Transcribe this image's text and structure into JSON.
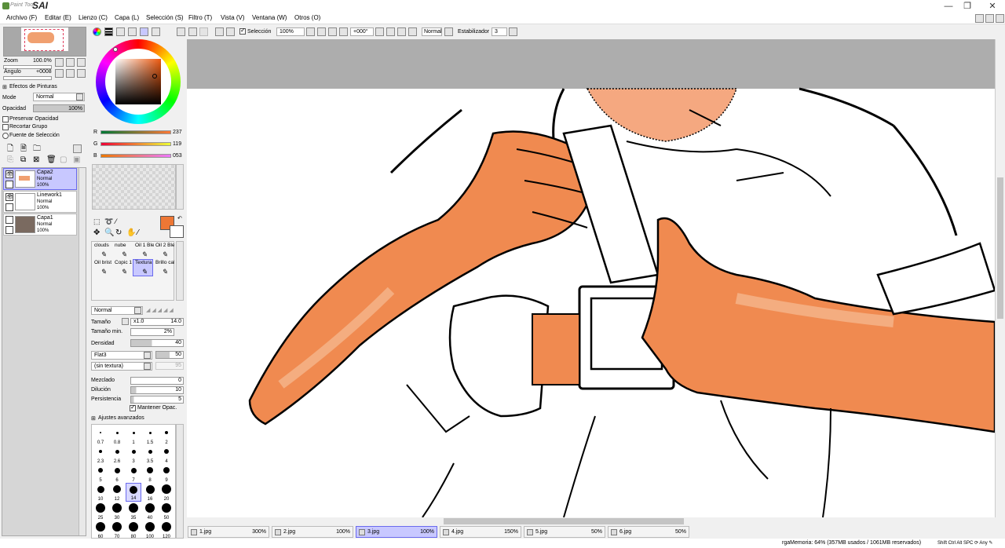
{
  "app": {
    "title_small": "Paint Tool",
    "title_big": "SAI"
  },
  "window_controls": {
    "minimize": "—",
    "restore": "❐",
    "close": "✕"
  },
  "menu": [
    "Archivo (F)",
    "Editar (E)",
    "Lienzo (C)",
    "Capa (L)",
    "Selección (S)",
    "Filtro (T)",
    "Vista (V)",
    "Ventana (W)",
    "Otros (O)"
  ],
  "navigator": {
    "zoom_label": "Zoom",
    "zoom_value": "100.0%",
    "angle_label": "Ángulo",
    "angle_value": "+0008"
  },
  "paint_effects": {
    "title": "Efectos de Pinturas",
    "mode_label": "Mode",
    "mode_value": "Normal",
    "opacity_label": "Opacidad",
    "opacity_value": "100%"
  },
  "layer_options": {
    "preserve_opacity": "Preservar Opacidad",
    "clip_group": "Recortar Grupo",
    "selection_source": "Fuente de Selección"
  },
  "layers": [
    {
      "name": "Capa2",
      "mode": "Normal",
      "opacity": "100%",
      "selected": true
    },
    {
      "name": "Linework1",
      "mode": "Normal",
      "opacity": "100%",
      "selected": false
    },
    {
      "name": "Capa1",
      "mode": "Normal",
      "opacity": "100%",
      "selected": false
    }
  ],
  "color": {
    "r_label": "R",
    "r_value": "237",
    "g_label": "G",
    "g_value": "119",
    "b_label": "B",
    "b_value": "053",
    "current_color": "#ed7735"
  },
  "brushes": [
    {
      "name": "clouds"
    },
    {
      "name": "nube"
    },
    {
      "name": "Oil 1 Ble"
    },
    {
      "name": "Oil 2 Ble"
    },
    {
      "name": "Oil brist"
    },
    {
      "name": "Copic 1"
    },
    {
      "name": "Textura",
      "selected": true
    },
    {
      "name": "Brillo cal"
    }
  ],
  "brush_settings": {
    "blend_mode": "Normal",
    "size_label": "Tamaño",
    "size_mult": "x1.0",
    "size_value": "14.0",
    "min_size_label": "Tamaño min.",
    "min_size_value": "2%",
    "density_label": "Densidad",
    "density_value": "40",
    "shape": "Flat3",
    "shape_value": "50",
    "texture": "(sin textura)",
    "texture_value": "95",
    "blend_label": "Mezclado",
    "blend_value": "0",
    "dilution_label": "Dilución",
    "dilution_value": "10",
    "persistence_label": "Persistencia",
    "persistence_value": "5",
    "keep_opacity": "Mantener Opac.",
    "advanced": "Ajustes avanzados"
  },
  "brush_sizes": [
    "0.7",
    "0.8",
    "1",
    "1.5",
    "2",
    "2.3",
    "2.6",
    "3",
    "3.5",
    "4",
    "5",
    "6",
    "7",
    "8",
    "9",
    "10",
    "12",
    "14",
    "16",
    "20",
    "25",
    "30",
    "35",
    "40",
    "50",
    "60",
    "70",
    "80",
    "100",
    "120"
  ],
  "selected_brush_size": "14",
  "toolbar": {
    "selection_label": "Selección",
    "zoom_value": "100%",
    "rotation_value": "+000°",
    "mode_value": "Normal",
    "stabilizer_label": "Estabilizador",
    "stabilizer_value": "3"
  },
  "tabs": [
    {
      "name": "1.jpg",
      "zoom": "300%"
    },
    {
      "name": "2.jpg",
      "zoom": "100%"
    },
    {
      "name": "3.jpg",
      "zoom": "100%",
      "selected": true
    },
    {
      "name": "4.jpg",
      "zoom": "150%"
    },
    {
      "name": "5.jpg",
      "zoom": "50%"
    },
    {
      "name": "6.jpg",
      "zoom": "50%"
    }
  ],
  "status": {
    "memory": "rgaMemoria: 64% (357MB usados / 1061MB reservados)",
    "keys": "Shift Ctrl Alt SPC ⟳ Any ✎"
  },
  "colors": {
    "accent": "#c8c8ff",
    "skin": "#ed7735",
    "canvas_gray": "#adadad"
  }
}
